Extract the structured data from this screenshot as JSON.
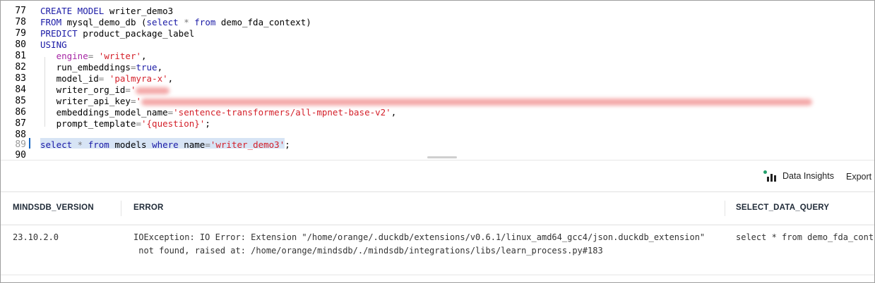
{
  "editor": {
    "line_numbers": [
      "77",
      "78",
      "79",
      "80",
      "81",
      "82",
      "83",
      "84",
      "85",
      "86",
      "87",
      "88",
      "89",
      "90"
    ],
    "lines": {
      "l77": [
        {
          "t": "CREATE MODEL ",
          "c": "kw"
        },
        {
          "t": "writer_demo3",
          "c": ""
        }
      ],
      "l78": [
        {
          "t": "FROM ",
          "c": "kw"
        },
        {
          "t": "mysql_demo_db (",
          "c": ""
        },
        {
          "t": "select",
          "c": "kw"
        },
        {
          "t": " * ",
          "c": "op"
        },
        {
          "t": "from",
          "c": "kw"
        },
        {
          "t": " demo_fda_context)",
          "c": ""
        }
      ],
      "l79": [
        {
          "t": "PREDICT ",
          "c": "kw"
        },
        {
          "t": "product_package_label",
          "c": ""
        }
      ],
      "l80": [
        {
          "t": "USING",
          "c": "kw"
        }
      ],
      "l81": [
        {
          "t": "   ",
          "c": ""
        },
        {
          "t": "engine",
          "c": "key"
        },
        {
          "t": "= ",
          "c": "op"
        },
        {
          "t": "'writer'",
          "c": "str"
        },
        {
          "t": ",",
          "c": ""
        }
      ],
      "l82": [
        {
          "t": "   run_embeddings",
          "c": ""
        },
        {
          "t": "=",
          "c": "op"
        },
        {
          "t": "true",
          "c": "kw"
        },
        {
          "t": ",",
          "c": ""
        }
      ],
      "l83": [
        {
          "t": "   model_id",
          "c": ""
        },
        {
          "t": "= ",
          "c": "op"
        },
        {
          "t": "'palmyra-x'",
          "c": "str"
        },
        {
          "t": ",",
          "c": ""
        }
      ],
      "l84": [
        {
          "t": "   writer_org_id",
          "c": ""
        },
        {
          "t": "=",
          "c": "op"
        },
        {
          "t": "'",
          "c": "str"
        }
      ],
      "l85": [
        {
          "t": "   writer_api_key",
          "c": ""
        },
        {
          "t": "=",
          "c": "op"
        },
        {
          "t": "'",
          "c": "str"
        }
      ],
      "l86": [
        {
          "t": "   embeddings_model_name",
          "c": ""
        },
        {
          "t": "=",
          "c": "op"
        },
        {
          "t": "'sentence-transformers/all-mpnet-base-v2'",
          "c": "str"
        },
        {
          "t": ",",
          "c": ""
        }
      ],
      "l87": [
        {
          "t": "   prompt_template",
          "c": ""
        },
        {
          "t": "=",
          "c": "op"
        },
        {
          "t": "'{question}'",
          "c": "str"
        },
        {
          "t": ";",
          "c": ""
        }
      ],
      "l88": [],
      "l89": [
        {
          "t": "select",
          "c": "kw"
        },
        {
          "t": " * ",
          "c": "op"
        },
        {
          "t": "from ",
          "c": "kw"
        },
        {
          "t": "models ",
          "c": ""
        },
        {
          "t": "where ",
          "c": "kw"
        },
        {
          "t": "name",
          "c": ""
        },
        {
          "t": "=",
          "c": "op"
        },
        {
          "t": "'writer_demo3'",
          "c": "str"
        },
        {
          "t": ";",
          "c": ""
        }
      ],
      "l90": []
    }
  },
  "toolbar": {
    "insights_label": "Data Insights",
    "export_label": "Export",
    "insights_icon": "chart-insights-icon",
    "accent_color": "#22a06b"
  },
  "table": {
    "headers": [
      "MINDSDB_VERSION",
      "ERROR",
      "SELECT_DATA_QUERY"
    ],
    "rows": [
      {
        "version": "23.10.2.0",
        "error_line1": "IOException: IO Error: Extension \"/home/orange/.duckdb/extensions/v0.6.1/linux_amd64_gcc4/json.duckdb_extension\"",
        "error_line2": " not found, raised at: /home/orange/mindsdb/./mindsdb/integrations/libs/learn_process.py#183",
        "query": "select * from demo_fda_cont"
      }
    ]
  }
}
